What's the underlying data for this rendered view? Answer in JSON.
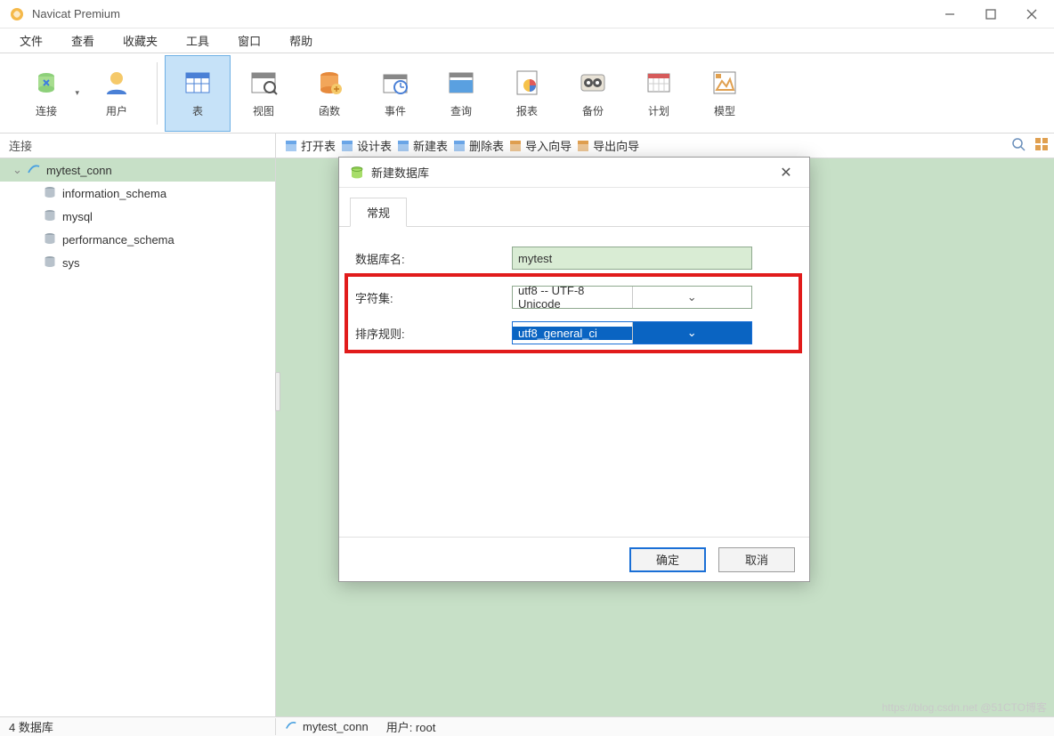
{
  "window": {
    "title": "Navicat Premium"
  },
  "menu": {
    "items": [
      "文件",
      "查看",
      "收藏夹",
      "工具",
      "窗口",
      "帮助"
    ]
  },
  "toolbar": {
    "items": [
      {
        "label": "连接",
        "id": "connect",
        "dropdown": true
      },
      {
        "label": "用户",
        "id": "user"
      },
      {
        "sep": true
      },
      {
        "label": "表",
        "id": "table",
        "active": true
      },
      {
        "label": "视图",
        "id": "view"
      },
      {
        "label": "函数",
        "id": "function"
      },
      {
        "label": "事件",
        "id": "event"
      },
      {
        "label": "查询",
        "id": "query"
      },
      {
        "label": "报表",
        "id": "report"
      },
      {
        "label": "备份",
        "id": "backup"
      },
      {
        "label": "计划",
        "id": "schedule"
      },
      {
        "label": "模型",
        "id": "model"
      }
    ]
  },
  "subbar": {
    "left_label": "连接",
    "ops": [
      "打开表",
      "设计表",
      "新建表",
      "删除表",
      "导入向导",
      "导出向导"
    ]
  },
  "tree": {
    "conn": "mytest_conn",
    "dbs": [
      "information_schema",
      "mysql",
      "performance_schema",
      "sys"
    ]
  },
  "dialog": {
    "title": "新建数据库",
    "tab": "常规",
    "fields": {
      "db_name_label": "数据库名:",
      "db_name_value": "mytest",
      "charset_label": "字符集:",
      "charset_value": "utf8 -- UTF-8 Unicode",
      "collation_label": "排序规则:",
      "collation_value": "utf8_general_ci"
    },
    "ok": "确定",
    "cancel": "取消"
  },
  "status": {
    "left": "4 数据库",
    "conn": "mytest_conn",
    "user": "用户: root"
  },
  "watermark": "https://blog.csdn.net @51CTO博客"
}
